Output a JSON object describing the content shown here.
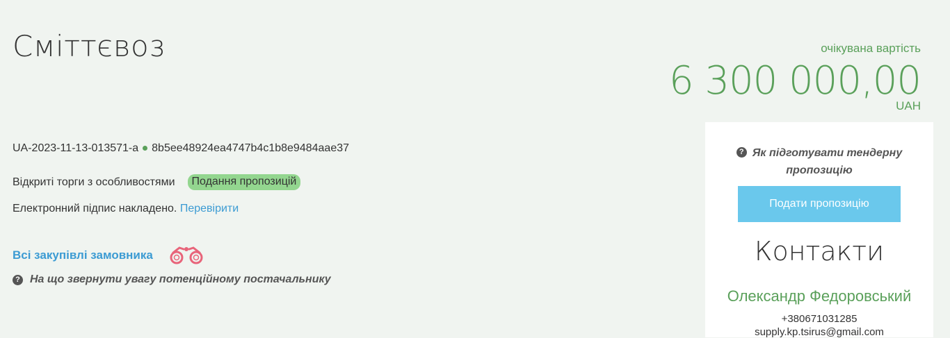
{
  "header": {
    "title": "Сміттєвоз"
  },
  "tender": {
    "id": "UA-2023-11-13-013571-a",
    "hash": "8b5ee48924ea4747b4c1b8e9484aae37",
    "procedure_type": "Відкриті торги з особливостями",
    "status_badge": "Подання пропозицій",
    "signature_text": "Електронний підпис накладено.",
    "signature_link": "Перевірити",
    "all_procurements_link": "Всі закупівлі замовника",
    "supplier_hint": "На що звернути увагу потенційному постачальнику"
  },
  "cost": {
    "label": "очікувана вартість",
    "value": "6 300 000,00",
    "currency": "UAH"
  },
  "panel": {
    "hint_line1": "Як підготувати тендерну",
    "hint_line2": "пропозицію",
    "submit_label": "Подати пропозицію",
    "contacts_title": "Контакти",
    "contact_name": "Олександр Федоровський",
    "contact_phone": "+380671031285",
    "contact_email": "supply.kp.tsirus@gmail.com"
  },
  "colors": {
    "accent_green": "#5aa05a",
    "link_blue": "#3c9bd3",
    "button_blue": "#6ac8ec",
    "badge_green": "#93d68f",
    "binoculars": "#e8647a"
  },
  "icons": {
    "question": "question-circle-icon",
    "binoculars": "binoculars-icon"
  }
}
